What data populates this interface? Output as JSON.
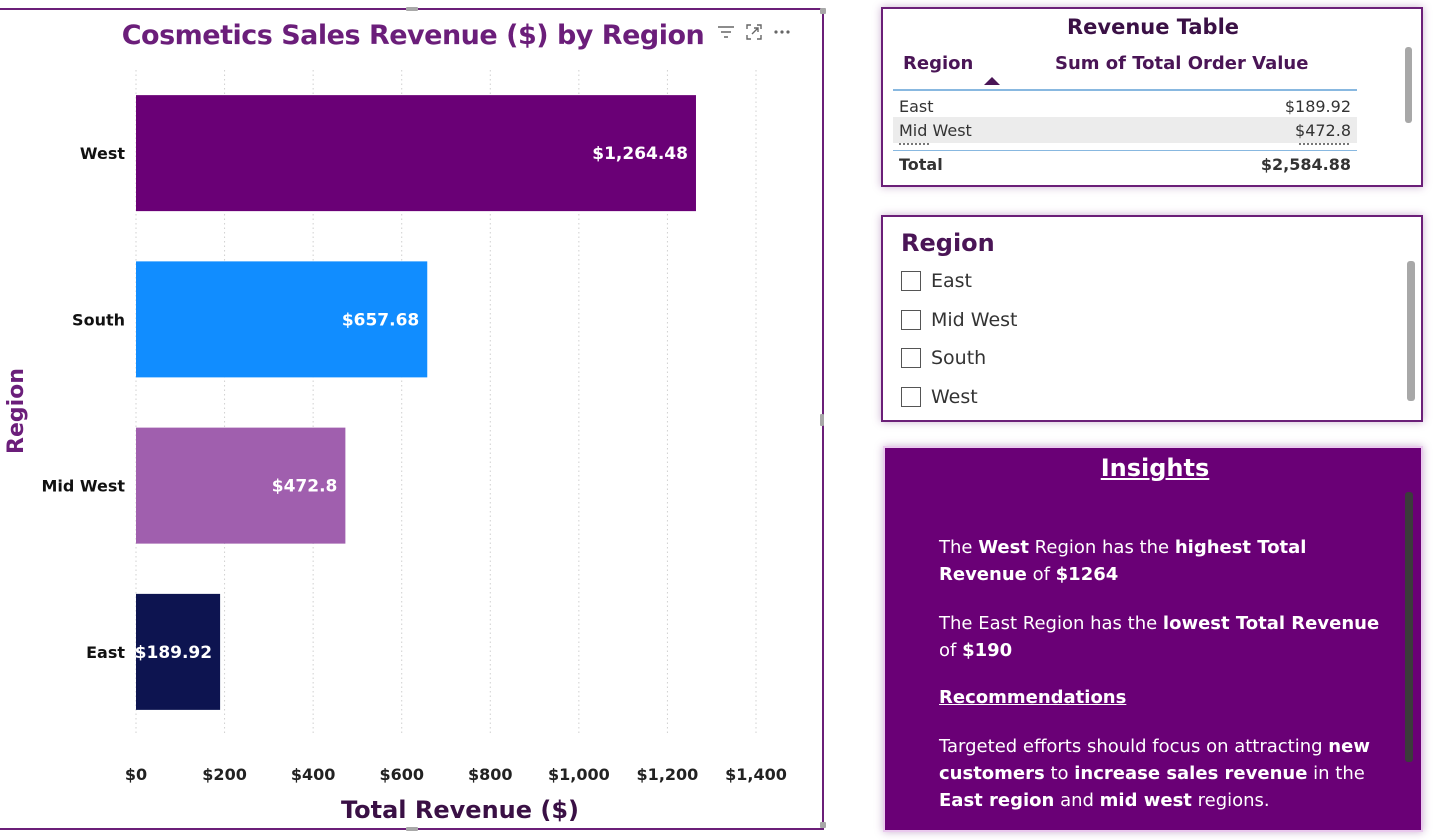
{
  "chart": {
    "title": "Cosmetics Sales Revenue ($) by Region",
    "toolbar": {
      "filter_icon": "filter-icon",
      "focus_icon": "focus-mode-icon",
      "more_icon": "more-options-icon"
    }
  },
  "chart_data": {
    "type": "bar",
    "orientation": "horizontal",
    "title": "Cosmetics Sales Revenue ($) by Region",
    "xlabel": "Total Revenue ($)",
    "ylabel": "Region",
    "categories": [
      "West",
      "South",
      "Mid West",
      "East"
    ],
    "values": [
      1264.48,
      657.68,
      472.8,
      189.92
    ],
    "data_labels": [
      "$1,264.48",
      "$657.68",
      "$472.8",
      "$189.92"
    ],
    "colors": [
      "#6a0076",
      "#118dff",
      "#a05fae",
      "#0d1450"
    ],
    "xlim": [
      0,
      1400
    ],
    "x_ticks": [
      0,
      200,
      400,
      600,
      800,
      1000,
      1200,
      1400
    ],
    "x_tick_labels": [
      "$0",
      "$200",
      "$400",
      "$600",
      "$800",
      "$1,000",
      "$1,200",
      "$1,400"
    ],
    "grid": "vertical dotted"
  },
  "table": {
    "title": "Revenue Table",
    "columns": [
      "Region",
      "Sum of Total Order Value"
    ],
    "rows": [
      {
        "region": "East",
        "value": "$189.92"
      },
      {
        "region": "Mid West",
        "value": "$472.8"
      }
    ],
    "total": {
      "label": "Total",
      "value": "$2,584.88"
    }
  },
  "slicer": {
    "title": "Region",
    "items": [
      "East",
      "Mid West",
      "South",
      "West"
    ]
  },
  "insights": {
    "title": "Insights",
    "p1": {
      "t1": "The ",
      "b1": "West",
      "t2": " Region has the ",
      "b2": "highest Total Revenue",
      "t3": " of ",
      "b3": "$1264"
    },
    "p2": {
      "t1": "The East Region has the ",
      "b1": "lowest Total Revenue",
      "t2": " of ",
      "b2": "$190"
    },
    "recommendations_heading": "Recommendations",
    "p3": {
      "t1": "Targeted efforts should focus on attracting ",
      "b1": "new customers",
      "t2": " to ",
      "b2": "increase sales revenue",
      "t3": " in the ",
      "b3": "East region",
      "t4": " and ",
      "b4": "mid west",
      "t5": " regions."
    }
  }
}
